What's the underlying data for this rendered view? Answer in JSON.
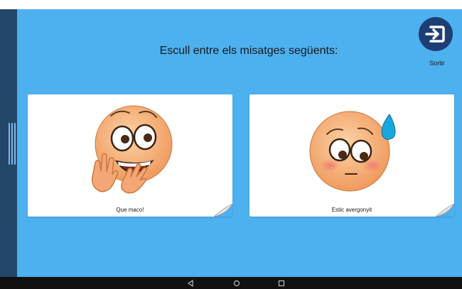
{
  "header": {
    "title": "Escull entre els misatges següents:"
  },
  "exit": {
    "label": "Sortir",
    "icon": "logout-icon"
  },
  "cards": [
    {
      "label": "Que maco!",
      "icon": "happy-clapping-emoji-icon"
    },
    {
      "label": "Estic avergonyit",
      "icon": "embarrassed-sweat-emoji-icon"
    }
  ],
  "navbar": {
    "buttons": [
      "back-icon",
      "home-icon",
      "recents-icon"
    ]
  },
  "colors": {
    "background": "#4db0ef",
    "rail": "#22476a",
    "exit_button": "#1d3f76",
    "card": "#ffffff",
    "emoji_skin": "#f5b27c",
    "tear": "#1aa7e0",
    "navbar": "#111111"
  }
}
